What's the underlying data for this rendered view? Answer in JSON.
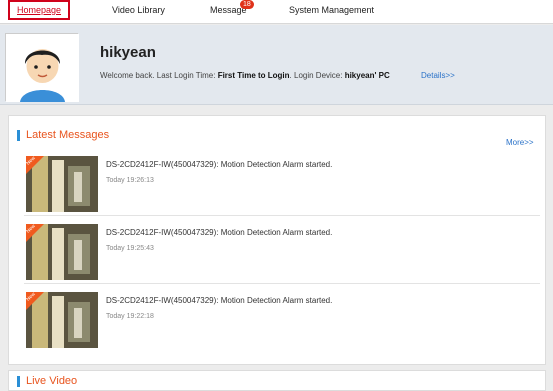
{
  "nav": {
    "tabs": [
      "Homepage",
      "Video Library",
      "Message",
      "System Management"
    ],
    "message_badge": "18"
  },
  "profile": {
    "username": "hikyean",
    "welcome_prefix": "Welcome back. Last Login Time: ",
    "last_login": "First Time to Login",
    "device_prefix": ". Login Device: ",
    "device": "hikyean' PC",
    "details": "Details>>"
  },
  "latest": {
    "title": "Latest Messages",
    "more": "More>>",
    "tag": "New",
    "messages": [
      {
        "text": "DS-2CD2412F-IW(450047329): Motion Detection Alarm started.",
        "time": "Today 19:26:13"
      },
      {
        "text": "DS-2CD2412F-IW(450047329): Motion Detection Alarm started.",
        "time": "Today 19:25:43"
      },
      {
        "text": "DS-2CD2412F-IW(450047329): Motion Detection Alarm started.",
        "time": "Today 19:22:18"
      }
    ]
  },
  "live": {
    "title": "Live Video"
  },
  "colors": {
    "accent_red": "#d0021b",
    "title_orange": "#e8541e",
    "link_blue": "#2a72c8"
  }
}
